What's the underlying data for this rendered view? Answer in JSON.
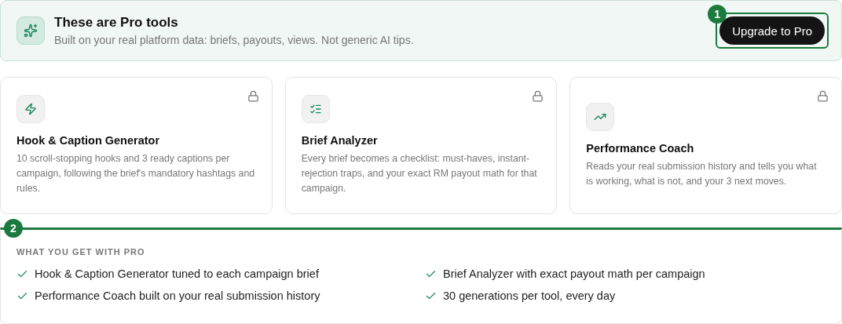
{
  "banner": {
    "title": "These are Pro tools",
    "subtitle": "Built on your real platform data: briefs, payouts, views. Not generic AI tips.",
    "button": "Upgrade to Pro",
    "marker": "1"
  },
  "tools": [
    {
      "kind": "bolt",
      "title": "Hook & Caption Generator",
      "description": "10 scroll-stopping hooks and 3 ready captions per campaign, following the brief's mandatory hashtags and rules.",
      "locked": true
    },
    {
      "kind": "checklist",
      "title": "Brief Analyzer",
      "description": "Every brief becomes a checklist: must-haves, instant-rejection traps, and your exact RM payout math for that campaign.",
      "locked": true
    },
    {
      "kind": "trend",
      "title": "Performance Coach",
      "description": "Reads your real submission history and tells you what is working, what is not, and your 3 next moves.",
      "locked": true
    }
  ],
  "benefits": {
    "marker": "2",
    "heading": "WHAT YOU GET WITH PRO",
    "items": [
      "Hook & Caption Generator tuned to each campaign brief",
      "Brief Analyzer with exact payout math per campaign",
      "Performance Coach built on your real submission history",
      "30 generations per tool, every day"
    ]
  }
}
